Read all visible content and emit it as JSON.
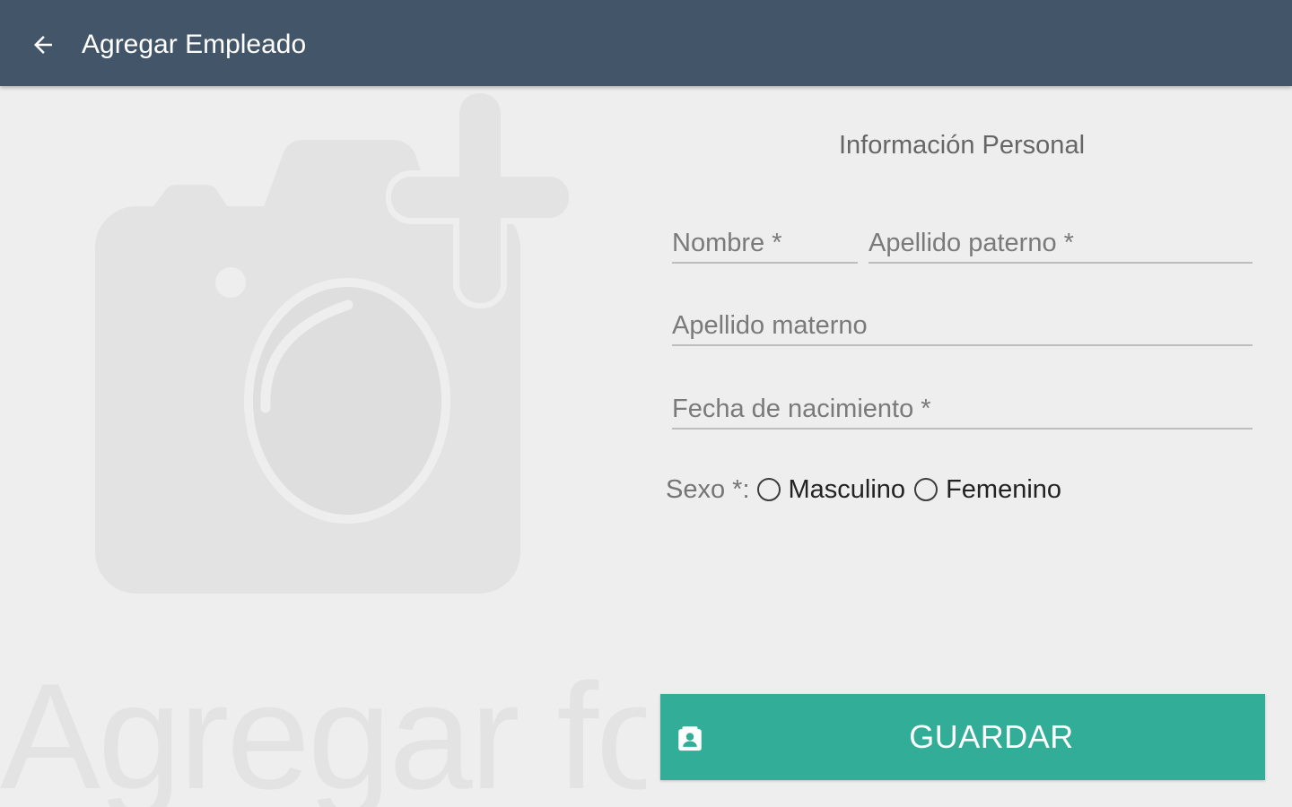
{
  "appbar": {
    "title": "Agregar Empleado",
    "back_icon": "arrow-left-icon",
    "background": "#435669"
  },
  "photo": {
    "label": "Agregar foto",
    "icon": "camera-add-icon"
  },
  "form": {
    "section_title": "Información Personal",
    "nombre_placeholder": "Nombre *",
    "apellido_paterno_placeholder": "Apellido paterno *",
    "apellido_materno_placeholder": "Apellido materno",
    "fecha_nacimiento_placeholder": "Fecha de nacimiento *",
    "sexo_label": "Sexo *:",
    "sexo_options": [
      "Masculino",
      "Femenino"
    ]
  },
  "save_button": {
    "label": "GUARDAR",
    "icon": "contact-badge-icon",
    "color": "#32ad98"
  }
}
